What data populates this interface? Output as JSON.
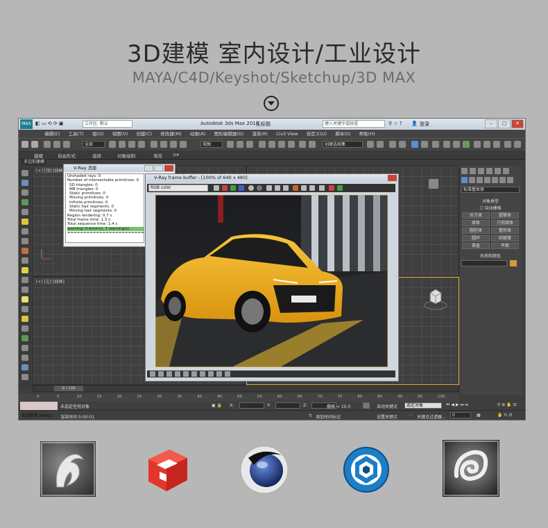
{
  "header": {
    "title": "3D建模 室内设计/工业设计",
    "subtitle": "MAYA/C4D/Keyshot/Sketchup/3D MAX"
  },
  "app": {
    "logo_text": "MAX",
    "workspace_label": "工作区: 默认",
    "window_title": "Autodesk 3ds Max 2016",
    "file_name": "无标题",
    "search_placeholder": "键入关键字或短语",
    "user_label": "登录",
    "menu": [
      "编辑(E)",
      "工具(T)",
      "组(G)",
      "视图(V)",
      "创建(C)",
      "修改器(M)",
      "动画(A)",
      "图形编辑器(D)",
      "渲染(R)",
      "Civil View",
      "自定义(U)",
      "脚本(S)",
      "帮助(H)"
    ],
    "toolbar": {
      "filter_value": "全部",
      "view_value": "视图",
      "selection_set": "创建选择集"
    },
    "ribbon": [
      "建模",
      "自由形式",
      "选择",
      "对象绘制",
      "填充"
    ],
    "ribbon_sub": "多边形建模",
    "viewports": {
      "top_left": "[+] [顶] [线框]",
      "bottom_left": "[+] [左] [线框]"
    }
  },
  "vray_messages": {
    "title": "V-Ray 消息",
    "lines": [
      "Unshaded rays: 0",
      "Number of intersectable primitives: 0",
      "SD triangles: 0",
      "MB triangles: 0",
      "Static primitives: 0",
      "Moving primitives: 0",
      "Infinite primitives: 0",
      "Static hair segments: 0",
      "Moving hair segments: 0",
      "Region rendering: 0.7 s",
      "Total frame time: 1.3 s",
      "Total sequence time: 1.4 s",
      "warning: 0 error(s), 1 warning(s)",
      "========================"
    ]
  },
  "vfb": {
    "title": "V-Ray frame buffer - [100% of 640 x 480]",
    "channel": "RGB color"
  },
  "command_panel": {
    "dropdown": "标准基本体",
    "section_object_type": "对象类型",
    "auto_grid": "自动栅格",
    "buttons": [
      "长方体",
      "圆锥体",
      "球体",
      "几何球体",
      "圆柱体",
      "管状体",
      "圆环",
      "四棱锥",
      "茶壶",
      "平面"
    ],
    "section_name_color": "名称和颜色"
  },
  "timeline": {
    "frame_display": "0 / 100",
    "ticks": [
      "0",
      "5",
      "10",
      "15",
      "20",
      "25",
      "30",
      "35",
      "40",
      "45",
      "50",
      "55",
      "60",
      "65",
      "70",
      "75",
      "80",
      "85",
      "90",
      "95",
      "100"
    ]
  },
  "status": {
    "selection": "未选定任何对象",
    "render_time": "渲染时间 0:00:01",
    "welcome": "欢迎使用 MAXSc",
    "x_label": "X:",
    "y_label": "Y:",
    "z_label": "Z:",
    "grid": "栅格 = 10.0",
    "add_time_tag": "添加时间标记",
    "auto_key": "自动关键点",
    "selected_object": "选定对象",
    "set_key": "设置关键点",
    "key_filter": "关键点过滤器...",
    "frame_value": "0"
  },
  "colors": {
    "page_bg": "#b7b7b7",
    "viewport_bg": "#3f3f3f",
    "car_yellow": "#f2b51c",
    "maya_bg": "#5a5a5a",
    "sketchup_red": "#e0362c",
    "c4d_blue": "#1d3f8f",
    "keyshot_blue": "#1c7fc6"
  },
  "bottom_logos": [
    "maya-logo",
    "sketchup-logo",
    "cinema4d-logo",
    "keyshot-logo",
    "3dsmax-logo"
  ]
}
